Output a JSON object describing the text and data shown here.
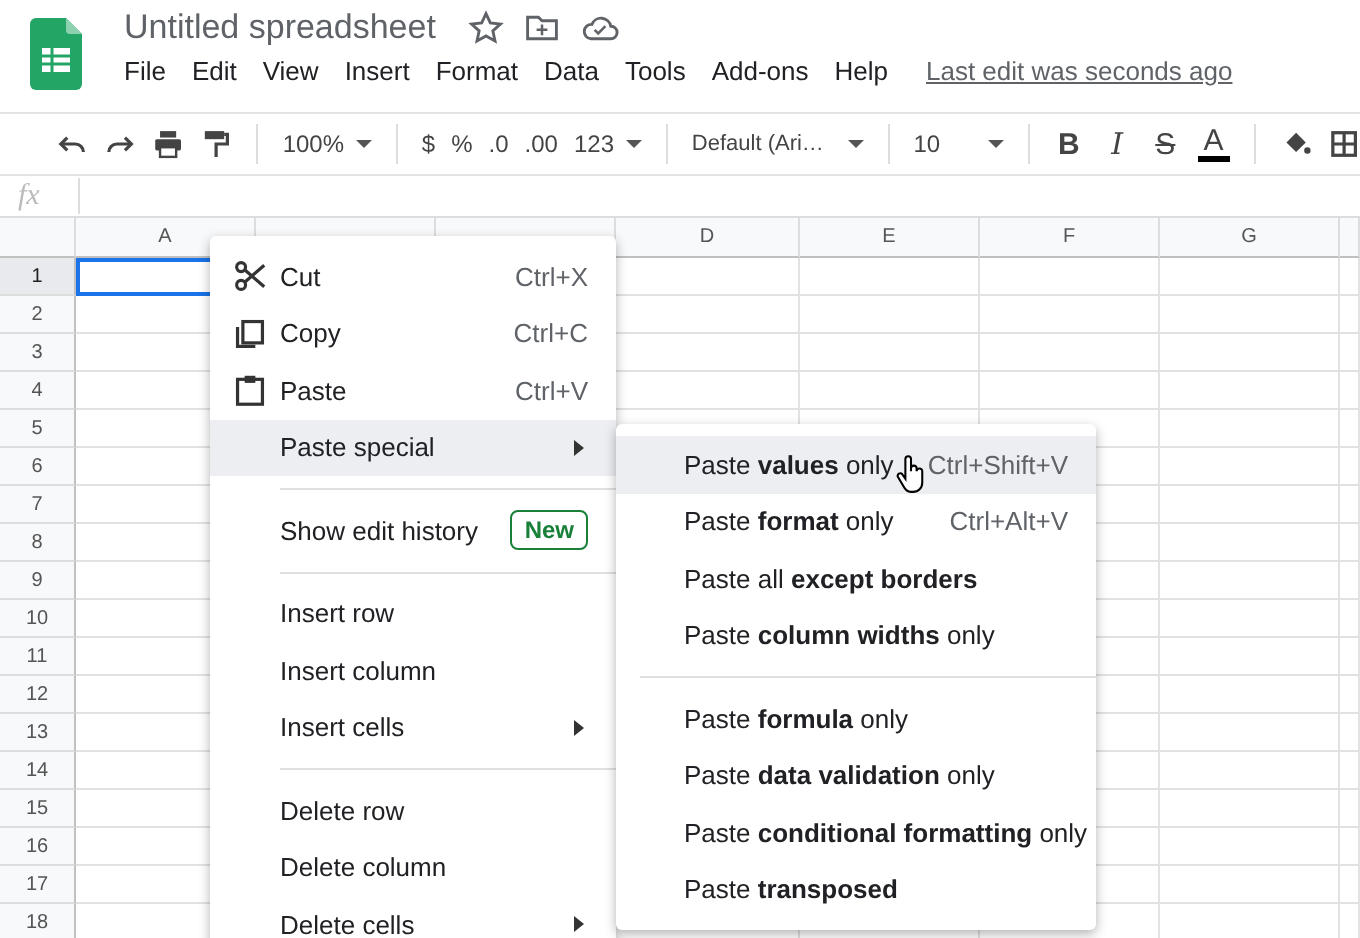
{
  "document": {
    "title": "Untitled spreadsheet",
    "last_edit": "Last edit was seconds ago"
  },
  "menubar": [
    "File",
    "Edit",
    "View",
    "Insert",
    "Format",
    "Data",
    "Tools",
    "Add-ons",
    "Help"
  ],
  "toolbar": {
    "zoom": "100%",
    "currency": "$",
    "percent": "%",
    "decrease_decimals": ".0",
    "increase_decimals": ".00",
    "number_format": "123",
    "font": "Default (Ari…",
    "font_size": "10",
    "bold": "B",
    "italic": "I",
    "strikethrough": "S",
    "text_color": "A"
  },
  "formula_bar": {
    "label": "fx"
  },
  "columns": [
    {
      "label": "A"
    },
    {},
    {},
    {
      "label": "D"
    },
    {
      "label": "E"
    },
    {
      "label": "F"
    },
    {
      "label": "G"
    }
  ],
  "rows": [
    {
      "label": "1",
      "selected": true
    },
    {
      "label": "2",
      "selected": false
    },
    {
      "label": "3",
      "selected": false
    },
    {
      "label": "4",
      "selected": false
    },
    {
      "label": "5",
      "selected": false
    },
    {
      "label": "6",
      "selected": false
    },
    {
      "label": "7",
      "selected": false
    },
    {
      "label": "8",
      "selected": false
    },
    {
      "label": "9",
      "selected": false
    },
    {
      "label": "10",
      "selected": false
    },
    {
      "label": "11",
      "selected": false
    },
    {
      "label": "12",
      "selected": false
    },
    {
      "label": "13",
      "selected": false
    },
    {
      "label": "14",
      "selected": false
    },
    {
      "label": "15",
      "selected": false
    },
    {
      "label": "16",
      "selected": false
    },
    {
      "label": "17",
      "selected": false
    },
    {
      "label": "18",
      "selected": false
    }
  ],
  "context_menu": {
    "groups": [
      [
        {
          "label": "Cut",
          "shortcut": "Ctrl+X",
          "submenu": false,
          "selected": false
        },
        {
          "label": "Copy",
          "shortcut": "Ctrl+C",
          "submenu": false,
          "selected": false
        },
        {
          "label": "Paste",
          "shortcut": "Ctrl+V",
          "submenu": false,
          "selected": false
        },
        {
          "label": "Paste special",
          "submenu": true,
          "selected": true
        }
      ],
      [
        {
          "label": "Show edit history",
          "badge": "New",
          "submenu": false,
          "selected": false
        }
      ],
      [
        {
          "label": "Insert row",
          "submenu": false,
          "selected": false
        },
        {
          "label": "Insert column",
          "submenu": false,
          "selected": false
        },
        {
          "label": "Insert cells",
          "submenu": true,
          "selected": false
        }
      ],
      [
        {
          "label": "Delete row",
          "submenu": false,
          "selected": false
        },
        {
          "label": "Delete column",
          "submenu": false,
          "selected": false
        },
        {
          "label": "Delete cells",
          "submenu": true,
          "selected": false
        }
      ]
    ]
  },
  "paste_special_menu": {
    "groups": [
      [
        {
          "label": "Paste **values** only",
          "shortcut": "Ctrl+Shift+V",
          "selected": true
        },
        {
          "label": "Paste **format** only",
          "shortcut": "Ctrl+Alt+V",
          "selected": false
        },
        {
          "label": "Paste all **except borders**",
          "selected": false
        },
        {
          "label": "Paste **column widths** only",
          "selected": false
        }
      ],
      [
        {
          "label": "Paste **formula** only",
          "selected": false
        },
        {
          "label": "Paste **data validation** only",
          "selected": false
        },
        {
          "label": "Paste **conditional formatting** only",
          "selected": false
        },
        {
          "label": "Paste **transposed**",
          "selected": false
        }
      ]
    ]
  }
}
